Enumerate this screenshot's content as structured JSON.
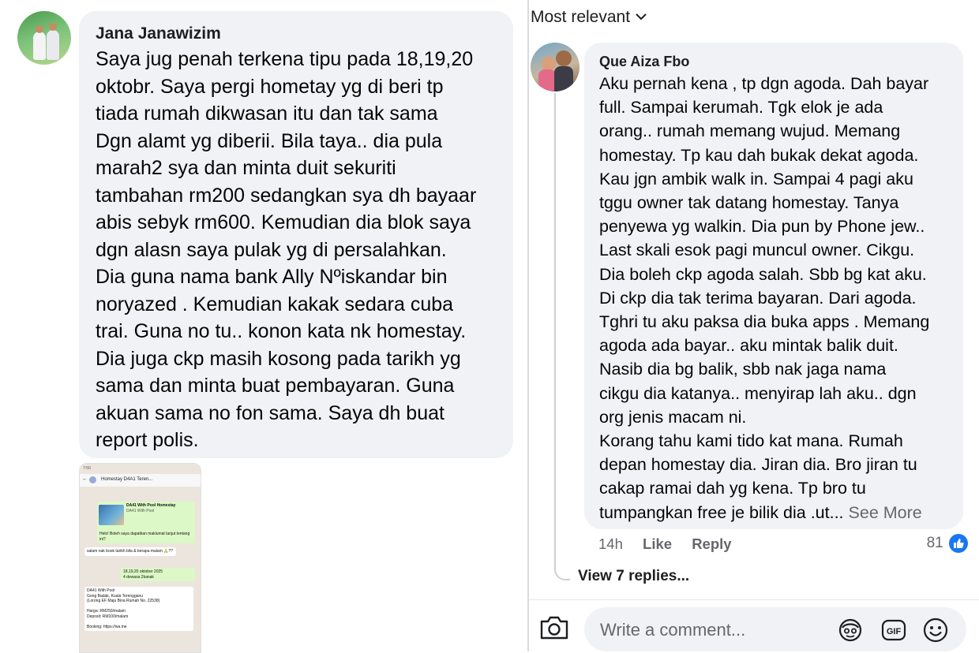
{
  "left_comment": {
    "author": "Jana Janawizim",
    "text": "Saya jug penah terkena tipu pada 18,19,20\noktobr. Saya pergi hometay yg di beri tp\ntiada rumah dikwasan itu dan tak sama\nDgn alamt yg diberii. Bila taya.. dia pula\nmarah2 sya dan minta duit sekuriti\ntambahan rm200 sedangkan sya dh bayaar\nabis sebyk rm600. Kemudian dia blok saya\ndgn alasn saya pulak yg di persalahkan.\nDia guna nama bank Ally Nºiskandar bin\nnoryazed . Kemudian kakak sedara cuba\ntrai. Guna no tu.. konon kata nk homestay.\nDia juga ckp masih kosong pada tarikh yg\nsama dan minta buat pembayaran. Guna\nakuan sama no fon sama. Saya dh buat\nreport polis.",
    "attachment": {
      "status_time": "7:50",
      "chat_title": "Homestay D4A1 Teren...",
      "listing_title": "DA41 With Pool Homestay",
      "listing_sub": "DA41 With Pool",
      "msg1": "Helo! Boleh saya dapatkan maklumat lanjut tentang ini?",
      "msg2": "salam nak book tarikh bila & berapa malam 🙏??",
      "msg3": "18,19,20 oktober 2025\n4 dewasa 2kanak",
      "msg4": "DA41 With Pool\nGong Badak, Kuala Terengganu\n(Lorong EF Maju Bina Rumah No. 22538)\n\nHarga: RM250/malam\nDeposit: RM100/malam\n\nBooking: https://wa.me"
    }
  },
  "right_panel": {
    "sort_label": "Most relevant",
    "comment": {
      "author": "Que Aiza Fbo",
      "text": "Aku pernah kena , tp dgn agoda. Dah bayar\nfull. Sampai kerumah. Tgk elok je ada\norang.. rumah memang wujud. Memang\nhomestay. Tp kau dah bukak dekat agoda.\nKau jgn ambik walk in. Sampai 4 pagi aku\ntggu owner tak datang homestay. Tanya\npenyewa yg walkin. Dia pun by Phone jew..\nLast skali esok pagi muncul owner. Cikgu.\nDia boleh ckp agoda salah. Sbb bg kat aku.\nDi ckp dia tak terima bayaran. Dari agoda.\nTghri tu aku paksa dia buka apps . Memang\nagoda ada bayar.. aku mintak balik duit.\nNasib dia bg balik,  sbb nak jaga nama\ncikgu dia katanya.. menyirap lah aku.. dgn\norg jenis macam ni.\nKorang tahu kami tido kat mana. Rumah\ndepan homestay dia. Jiran dia. Bro jiran tu\ncakap ramai dah yg kena. Tp bro tu\ntumpangkan free je bilik dia .ut...",
      "see_more": "See More",
      "time": "14h",
      "like_label": "Like",
      "reply_label": "Reply",
      "like_count": "81"
    },
    "view_replies": "View 7 replies...",
    "composer": {
      "placeholder": "Write a comment...",
      "gif_label": "GIF"
    }
  },
  "colors": {
    "bubble_bg": "#f0f2f5",
    "muted_text": "#65676b",
    "like_blue": "#1877f2"
  }
}
